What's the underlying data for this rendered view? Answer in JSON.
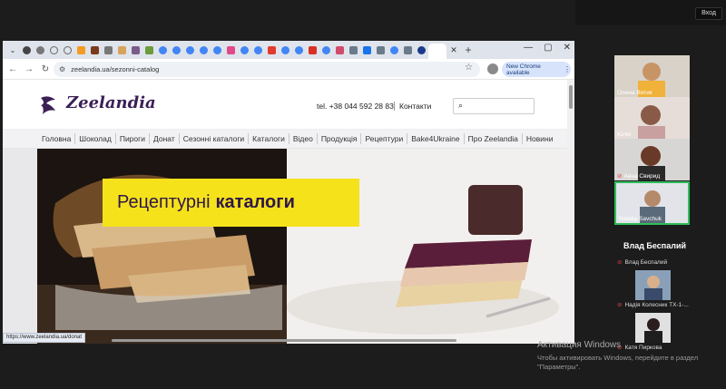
{
  "meeting": {
    "enter_button": "Вход",
    "active_speaker": "Влад Беспалий",
    "participants": [
      {
        "name": "Олена Вятик"
      },
      {
        "name": "Юлія"
      },
      {
        "name": "Анна Свирид"
      },
      {
        "name": "Natalia Savchuk"
      }
    ],
    "list": [
      {
        "name": "Влад Беспалий"
      },
      {
        "name": "Надія Колесник ТХ-1-..."
      },
      {
        "name": "Катя Пиркова"
      }
    ]
  },
  "browser": {
    "url": "zeelandia.ua/sezonni-catalog",
    "new_chrome": "New Chrome available",
    "new_tab": "+",
    "status_url": "https://www.zeelandia.ua/donat"
  },
  "site": {
    "logo": "Zeelandia",
    "phone": "tel. +38 044 592 28 83",
    "contacts": "Контакти",
    "menu": [
      "Головна",
      "Шоколад",
      "Пироги",
      "Донат",
      "Сезонні каталоги",
      "Каталоги",
      "Відео",
      "Продукція",
      "Рецептури",
      "Bake4Ukraine",
      "Про Zeelandia",
      "Новини"
    ],
    "banner_light": "Рецептурні",
    "banner_bold": "каталоги"
  },
  "windows": {
    "watermark_title": "Активация Windows",
    "watermark_text": "Чтобы активировать Windows, перейдите в раздел \"Параметры\"."
  },
  "colors": {
    "brand": "#3b1f55",
    "banner": "#f5e21a",
    "active_tile": "#2fbd5b"
  },
  "icons": [
    "back-arrow-icon",
    "forward-arrow-icon",
    "reload-icon",
    "star-icon",
    "search-icon",
    "kebab-menu-icon",
    "microphone-off-icon"
  ]
}
